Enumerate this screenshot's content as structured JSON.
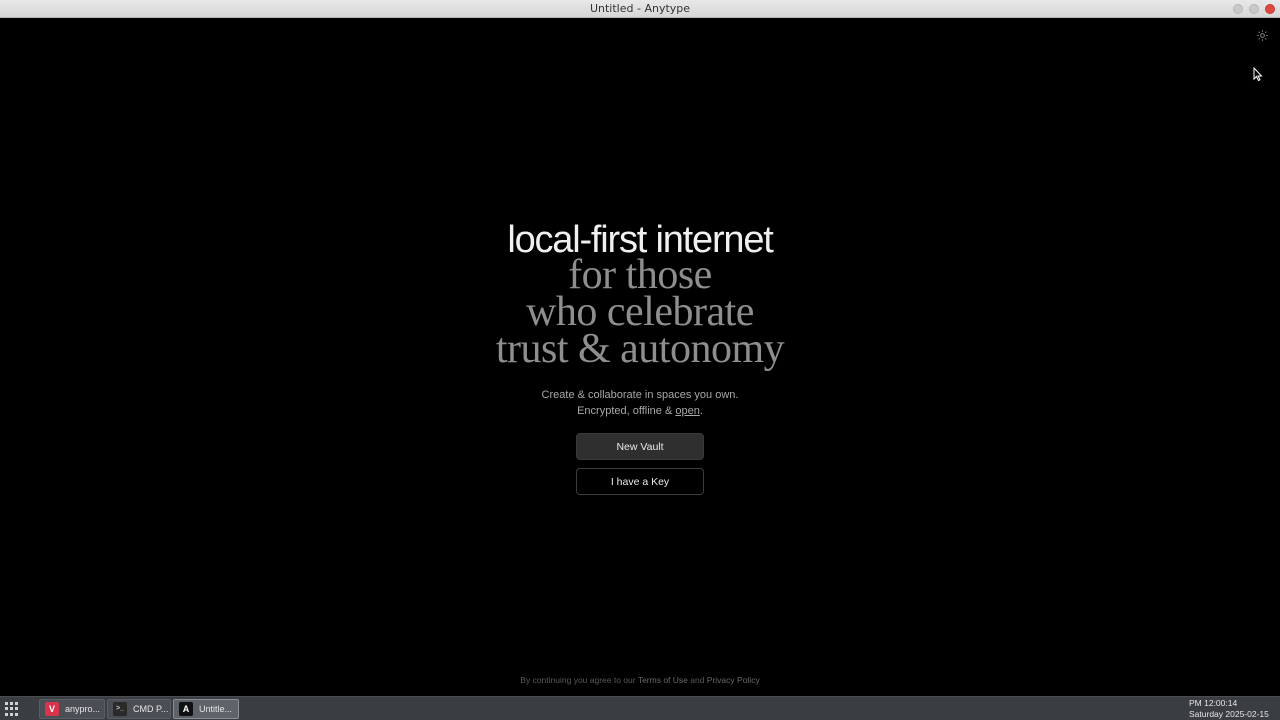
{
  "window": {
    "title": "Untitled - Anytype"
  },
  "hero": {
    "line1": "local-first internet",
    "line2": "for those",
    "line3": "who celebrate",
    "line4": "trust & autonomy"
  },
  "subtitle": {
    "line1": "Create & collaborate in spaces you own.",
    "line2_prefix": "Encrypted, offline & ",
    "line2_link": "open",
    "line2_suffix": "."
  },
  "buttons": {
    "new_vault": "New Vault",
    "have_key": "I have a Key"
  },
  "legal": {
    "prefix": "By continuing you agree to our ",
    "terms": "Terms of Use",
    "and": " and ",
    "privacy": "Privacy Policy"
  },
  "taskbar": {
    "items": [
      {
        "label": "anypro...",
        "icon": "V"
      },
      {
        "label": "CMD P...",
        "icon": ">_"
      },
      {
        "label": "Untitle...",
        "icon": "A"
      }
    ],
    "clock_time": "PM 12:00:14",
    "clock_date": "Saturday 2025-02-15"
  },
  "colors": {
    "background": "#000000",
    "hero_primary": "#f0f0f0",
    "hero_secondary": "#8e8e8e",
    "close_button": "#e0473f"
  },
  "icons": {
    "settings": "gear-icon",
    "apps": "app-grid-icon"
  }
}
